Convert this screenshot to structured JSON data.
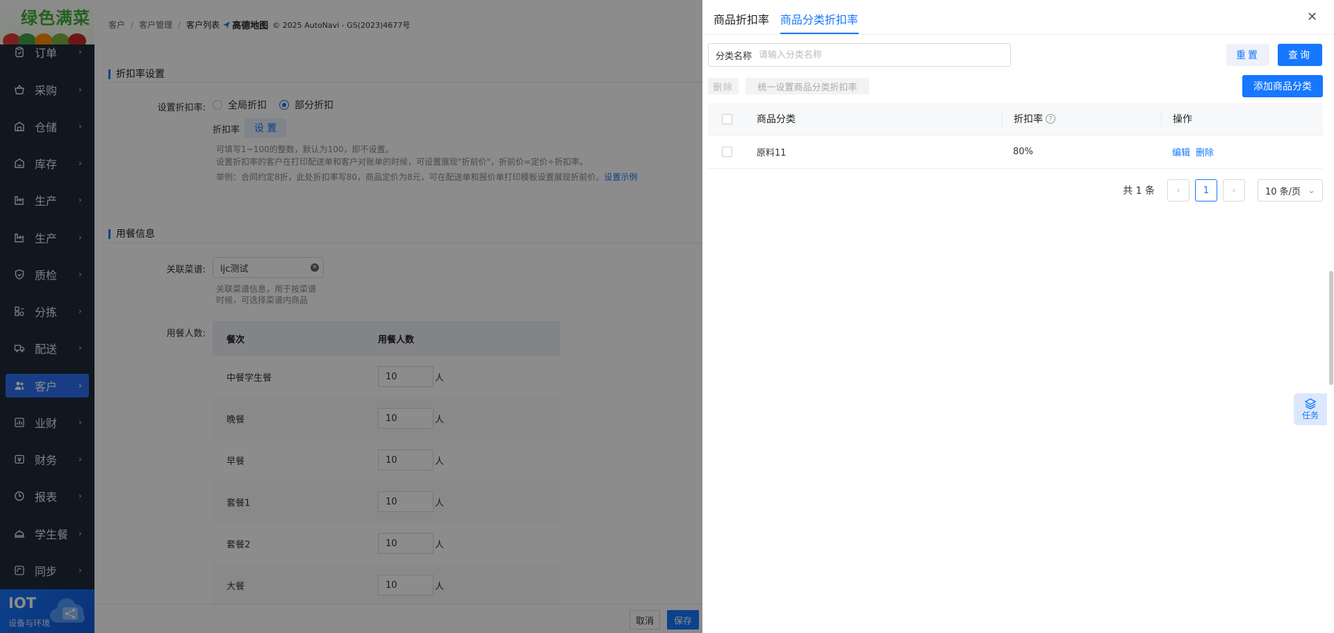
{
  "sidebar": {
    "logo_text": "绿色满菜",
    "items": [
      {
        "label": "订单",
        "icon": "clipboard-icon"
      },
      {
        "label": "采购",
        "icon": "basket-icon"
      },
      {
        "label": "仓储",
        "icon": "warehouse-icon"
      },
      {
        "label": "库存",
        "icon": "stock-icon"
      },
      {
        "label": "生产",
        "icon": "factory-icon"
      },
      {
        "label": "生产",
        "icon": "factory-icon"
      },
      {
        "label": "质检",
        "icon": "shield-check-icon"
      },
      {
        "label": "分拣",
        "icon": "sorting-icon"
      },
      {
        "label": "配送",
        "icon": "truck-icon"
      },
      {
        "label": "客户",
        "icon": "users-icon"
      },
      {
        "label": "业财",
        "icon": "bar-chart-icon"
      },
      {
        "label": "财务",
        "icon": "finance-icon"
      },
      {
        "label": "报表",
        "icon": "report-icon"
      },
      {
        "label": "学生餐",
        "icon": "meal-icon"
      },
      {
        "label": "同步",
        "icon": "sync-icon"
      }
    ],
    "iot_title": "IOT",
    "iot_subtitle": "设备与环境"
  },
  "main": {
    "breadcrumb": [
      "客户",
      "客户管理",
      "客户列表"
    ],
    "map_logo": "高德地图",
    "map_copyright": "© 2025 AutoNavi - GS(2023)4677号",
    "discount_section": {
      "title": "折扣率设置",
      "label": "设置折扣率:",
      "option_global": "全局折扣",
      "option_partial": "部分折扣",
      "selected": "部分折扣",
      "rate_label": "折扣率",
      "set_button": "设 置",
      "hint1": "可填写1~100的整数，默认为100，即不设置。",
      "hint2": "设置折扣率的客户在打印配送单和客户对账单的时候，可设置展现\"折前价\"，折前价=定价÷折扣率。",
      "hint3": "举例：合同约定8折，此处折扣率写80，商品定价为8元，可在配送单和报价单打印模板设置展现折前价。",
      "hint_link": "设置示例"
    },
    "meal_section": {
      "title": "用餐信息",
      "menu_label": "关联菜谱:",
      "menu_value": "ljc测试",
      "menu_hint1": "关联菜谱信息，用于按菜谱",
      "menu_hint2": "时候，可选择菜谱内商品",
      "people_label": "用餐人数:",
      "columns": [
        "餐次",
        "用餐人数"
      ],
      "unit": "人",
      "rows": [
        {
          "meal": "中餐学生餐",
          "count": "10"
        },
        {
          "meal": "晚餐",
          "count": "10"
        },
        {
          "meal": "早餐",
          "count": "10"
        },
        {
          "meal": "套餐1",
          "count": "10"
        },
        {
          "meal": "套餐2",
          "count": "10"
        },
        {
          "meal": "大餐",
          "count": "10"
        }
      ]
    },
    "footer": {
      "cancel": "取消",
      "save": "保存"
    }
  },
  "drawer": {
    "tabs": [
      {
        "label": "商品折扣率",
        "active": false
      },
      {
        "label": "商品分类折扣率",
        "active": true
      }
    ],
    "filter": {
      "label": "分类名称",
      "placeholder": "请输入分类名称",
      "value": ""
    },
    "reset_button": "重置",
    "query_button": "查询",
    "delete_button": "删除",
    "batch_button": "统一设置商品分类折扣率",
    "add_button": "添加商品分类",
    "table": {
      "columns": [
        "商品分类",
        "折扣率",
        "操作"
      ],
      "rows": [
        {
          "category": "原料11",
          "rate": "80%",
          "edit": "编辑",
          "delete": "删除"
        }
      ]
    },
    "pagination": {
      "total": "共 1 条",
      "current": "1",
      "page_size": "10 条/页"
    },
    "task_label": "任务"
  },
  "colors": {
    "primary": "#1677ff",
    "sidebar_bg": "#1e2a3a",
    "active_nav": "#2c6ff2"
  }
}
